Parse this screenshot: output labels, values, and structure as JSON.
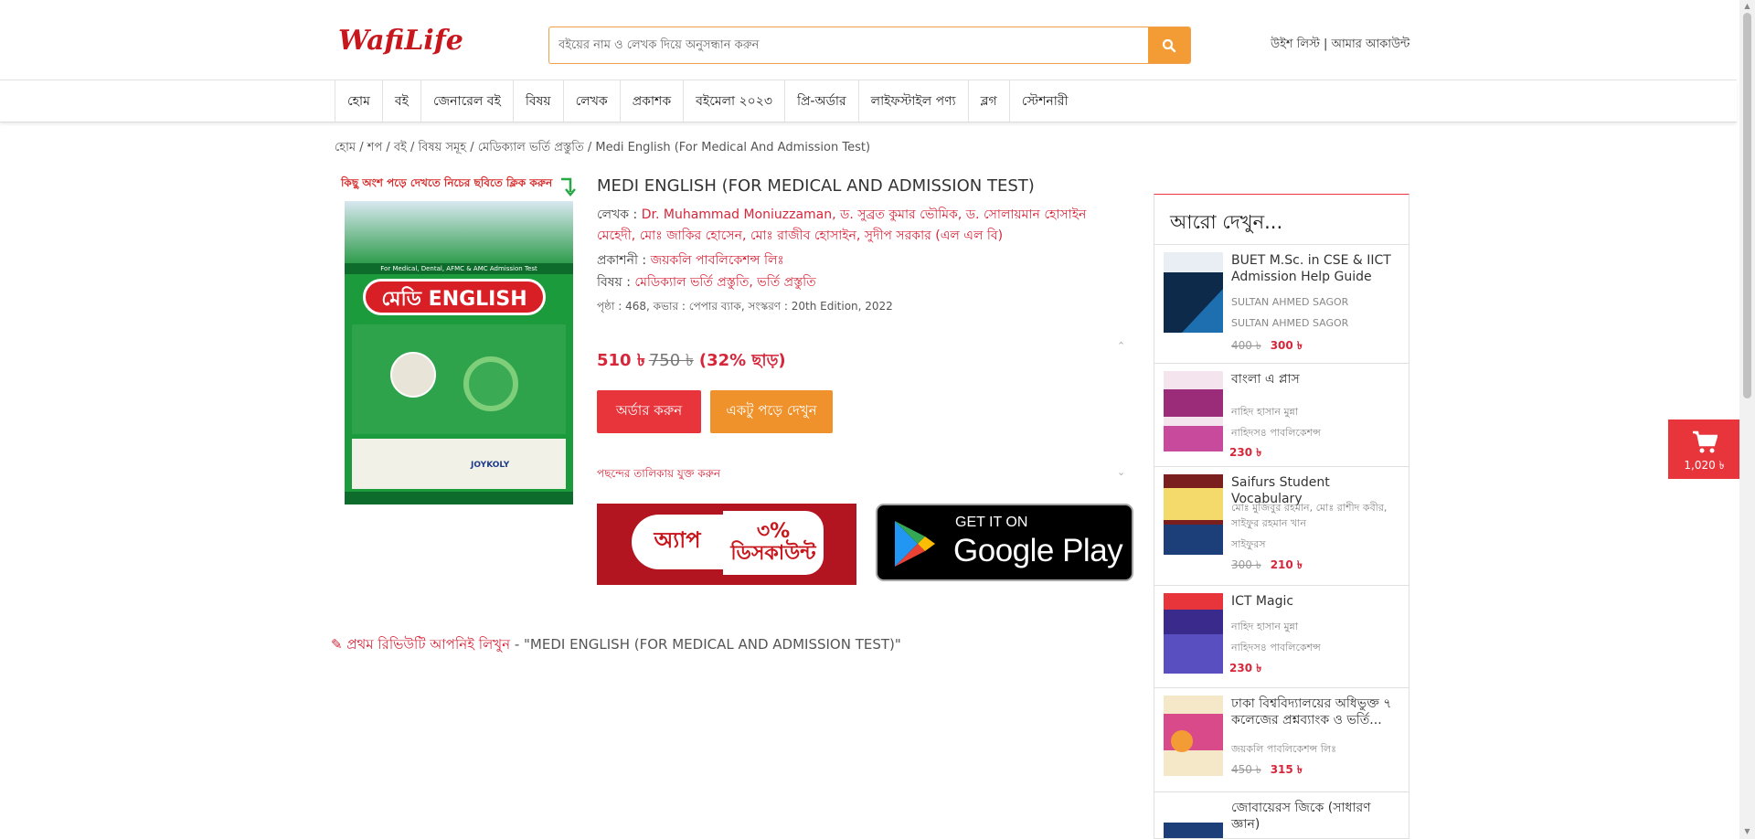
{
  "header": {
    "logo_text": "WafiLife",
    "search_placeholder": "বইয়ের নাম ও লেখক দিয়ে অনুসন্ধান করুন",
    "wishlist": "উইশ লিস্ট",
    "separator": " | ",
    "account": "আমার আকাউন্ট"
  },
  "nav": {
    "items": [
      "হোম",
      "বই",
      "জেনারেল বই",
      "বিষয়",
      "লেখক",
      "প্রকাশক",
      "বইমেলা ২০২৩",
      "প্রি-অর্ডার",
      "লাইফস্টাইল পণ্য",
      "ব্লগ",
      "স্টেশনারী"
    ]
  },
  "breadcrumb": "হোম / শপ / বই / বিষয় সমূহ / মেডিক্যাল ভর্তি প্রস্তুতি / Medi English (For Medical And Admission Test)",
  "product": {
    "hint": "কিছু অংশ পড়ে দেখতে নিচের ছবিতে ক্লিক করুন",
    "cover_band": "For Medical, Dental, AFMC & AMC Admission Test",
    "cover_title": "মেডি ENGLISH",
    "cover_brand": "JOYKOLY",
    "title": "MEDI ENGLISH (FOR MEDICAL AND ADMISSION TEST)",
    "author_label": "লেখক : ",
    "authors": "Dr. Muhammad Moniuzzaman, ড. সুব্রত কুমার ভৌমিক, ড. সোলায়মান হোসাইন মেহেদী, মোঃ জাকির হোসেন, মোঃ রাজীব হোসাইন, সুদীপ সরকার (এল এল বি)",
    "publisher_label": "প্রকাশনী : ",
    "publisher": "জয়কলি পাবলিকেশন্স লিঃ",
    "subject_label": "বিষয় : ",
    "subjects": "মেডিক্যাল ভর্তি প্রস্তুতি, ভর্তি প্রস্তুতি",
    "details": "পৃষ্ঠা : 468, কভার : পেপার ব্যাক, সংস্করণ : 20th Edition, 2022",
    "price": "510 ৳",
    "old_price": "750 ৳",
    "discount": "(32% ছাড়)",
    "order_button": "অর্ডার করুন",
    "read_button": "একটু পড়ে দেখুন",
    "wishlist_link": "পছন্দের তালিকায় যুক্ত করুন",
    "promo_left": "অ্যাপ",
    "promo_right": "৩% ডিসকাউন্ট",
    "gplay_small": "GET IT ON",
    "gplay_big": "Google Play"
  },
  "review": {
    "link": "প্রথম রিভিউটি আপনিই লিখুন",
    "suffix": " - \"MEDI ENGLISH (FOR MEDICAL AND ADMISSION TEST)\""
  },
  "sidebar": {
    "heading": "আরো দেখুন...",
    "items": [
      {
        "title": "BUET M.Sc. in CSE & IICT Admission Help Guide",
        "line1": "SULTAN AHMED SAGOR",
        "line2": "SULTAN AHMED SAGOR",
        "old": "400 ৳",
        "price": "300 ৳"
      },
      {
        "title": "বাংলা এ প্লাস",
        "line1": "নাহিদ হাসান মুন্না",
        "line2": "নাহিদস৪ পাবলিকেশন্স",
        "price": "230 ৳"
      },
      {
        "title": "Saifurs Student Vocabulary",
        "line1": "মোঃ মুজিবুর রহমান, মোঃ রাশীদ কবীর,",
        "line1b": "সাইফুর রহমান খান",
        "line2": "সাইফুরস",
        "old": "300 ৳",
        "price": "210 ৳"
      },
      {
        "title": "ICT Magic",
        "line1": "নাহিদ হাসান মুন্না",
        "line2": "নাহিদস৪ পাবলিকেশন্স",
        "price": "230 ৳"
      },
      {
        "title": "ঢাকা বিশ্ববিদ্যালয়ের অধিভুক্ত ৭ কলেজের প্রশ্নব্যাংক ও ভর্তি...",
        "line1": "জয়কলি পাবলিকেশন্স লিঃ",
        "old": "450 ৳",
        "price": "315 ৳"
      },
      {
        "title": "জোবায়েরস জিকে (সাধারণ জ্ঞান)"
      }
    ]
  },
  "cart": {
    "total": "1,020 ৳"
  },
  "colors": {
    "brand_red": "#e8353c",
    "orange": "#f0922b",
    "link_red": "#d6263a"
  }
}
